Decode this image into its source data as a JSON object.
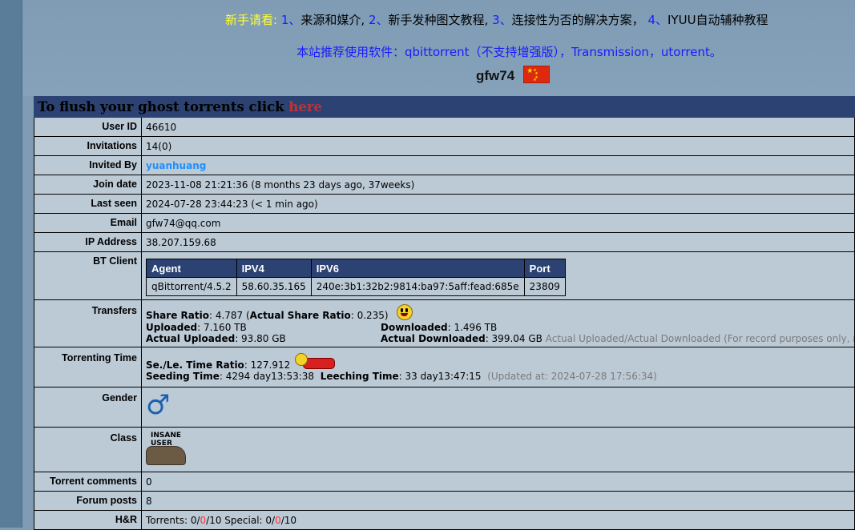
{
  "header": {
    "notice_prefix": "新手请看:",
    "notice_links": [
      {
        "num": "1、",
        "text": "来源和媒介"
      },
      {
        "num": "2、",
        "text": "新手发种图文教程"
      },
      {
        "num": "3、",
        "text": "连接性为否的解决方案"
      },
      {
        "num": "4、",
        "text": "IYUU自动辅种教程"
      }
    ],
    "software_line": "本站推荐使用软件：qbittorrent（不支持增强版），Transmission，utorrent。",
    "username": "gfw74"
  },
  "title_bar": {
    "prefix": "To flush your ghost torrents click ",
    "link": "here"
  },
  "profile": {
    "user_id": {
      "label": "User ID",
      "value": "46610"
    },
    "invitations": {
      "label": "Invitations",
      "value": "14(0)"
    },
    "invited_by": {
      "label": "Invited By",
      "value": "yuanhuang"
    },
    "join_date": {
      "label": "Join date",
      "value": "2023-11-08 21:21:36 (8 months 23 days ago, 37weeks)"
    },
    "last_seen": {
      "label": "Last seen",
      "value": "2024-07-28 23:44:23 (< 1 min ago)"
    },
    "email": {
      "label": "Email",
      "value": "gfw74@qq.com"
    },
    "ip": {
      "label": "IP Address",
      "value": "38.207.159.68"
    },
    "bt_client": {
      "label": "BT Client",
      "headers": [
        "Agent",
        "IPV4",
        "IPV6",
        "Port"
      ],
      "row": [
        "qBittorrent/4.5.2",
        "58.60.35.165",
        "240e:3b1:32b2:9814:ba97:5aff:fead:685e",
        "23809"
      ]
    },
    "transfers": {
      "label": "Transfers",
      "share_ratio_label": "Share Ratio",
      "share_ratio": "4.787",
      "actual_ratio_label": "Actual Share Ratio",
      "actual_ratio": "0.235",
      "uploaded_label": "Uploaded",
      "uploaded": "7.160 TB",
      "downloaded_label": "Downloaded",
      "downloaded": "1.496 TB",
      "actual_uploaded_label": "Actual Uploaded",
      "actual_uploaded": "93.80 GB",
      "actual_downloaded_label": "Actual Downloaded",
      "actual_downloaded": "399.04 GB",
      "note": "Actual Uploaded/Actual Downloaded (For record purposes only, not for share"
    },
    "torrenting_time": {
      "label": "Torrenting Time",
      "ratio_label": "Se./Le. Time Ratio",
      "ratio": "127.912",
      "seeding_label": "Seeding Time",
      "seeding": "4294 day13:53:38",
      "leeching_label": "Leeching Time",
      "leeching": "33 day13:47:15",
      "updated": "(Updated at: 2024-07-28 17:56:34)"
    },
    "gender": {
      "label": "Gender",
      "symbol": "♂"
    },
    "class": {
      "label": "Class",
      "badge_line1": "INSANE",
      "badge_line2": "USER"
    },
    "torrent_comments": {
      "label": "Torrent comments",
      "value": "0"
    },
    "forum_posts": {
      "label": "Forum posts",
      "value": "8"
    },
    "hnr": {
      "label": "H&R",
      "torrents_label": "Torrents: ",
      "t_a": "0",
      "t_b": "0",
      "t_c": "10",
      "special_label": " Special: ",
      "s_a": "0",
      "s_b": "0",
      "s_c": "10"
    }
  }
}
